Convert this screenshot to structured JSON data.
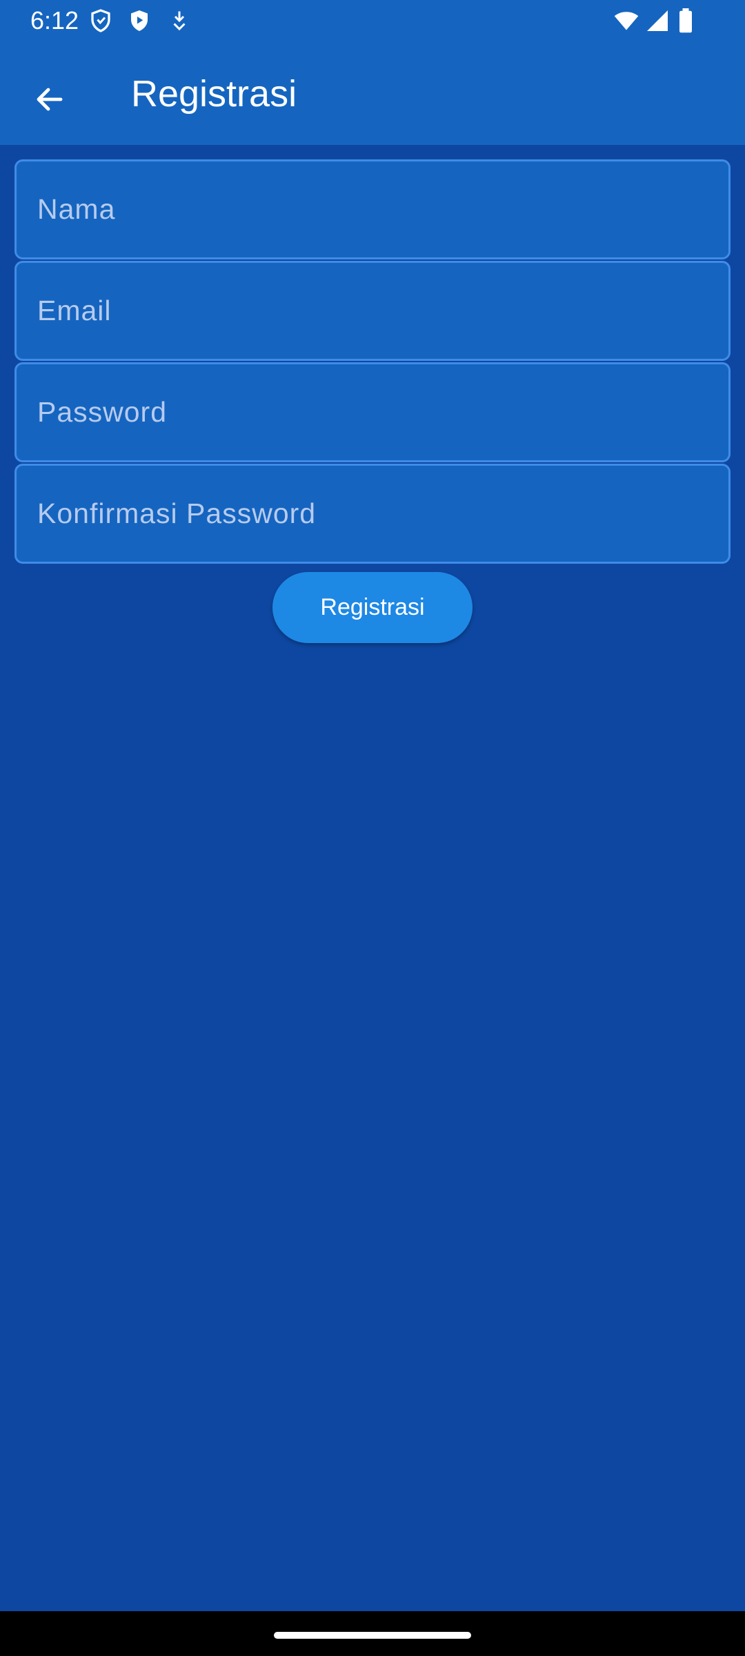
{
  "status_bar": {
    "time": "6:12",
    "left_icons": [
      "shield-icon",
      "play-protect-icon",
      "download-icon"
    ],
    "right_icons": [
      "wifi-icon",
      "signal-icon",
      "battery-icon"
    ]
  },
  "app_bar": {
    "back_icon": "arrow-back-icon",
    "title": "Registrasi"
  },
  "form": {
    "fields": [
      {
        "placeholder": "Nama",
        "value": ""
      },
      {
        "placeholder": "Email",
        "value": ""
      },
      {
        "placeholder": "Password",
        "value": ""
      },
      {
        "placeholder": "Konfirmasi Password",
        "value": ""
      }
    ],
    "submit_label": "Registrasi"
  },
  "colors": {
    "app_bar": "#1565c0",
    "background": "#0e47a1",
    "field_fill": "#1565c0",
    "field_border": "#3f8ce8",
    "button": "#1e88e5",
    "text": "#ffffff"
  }
}
